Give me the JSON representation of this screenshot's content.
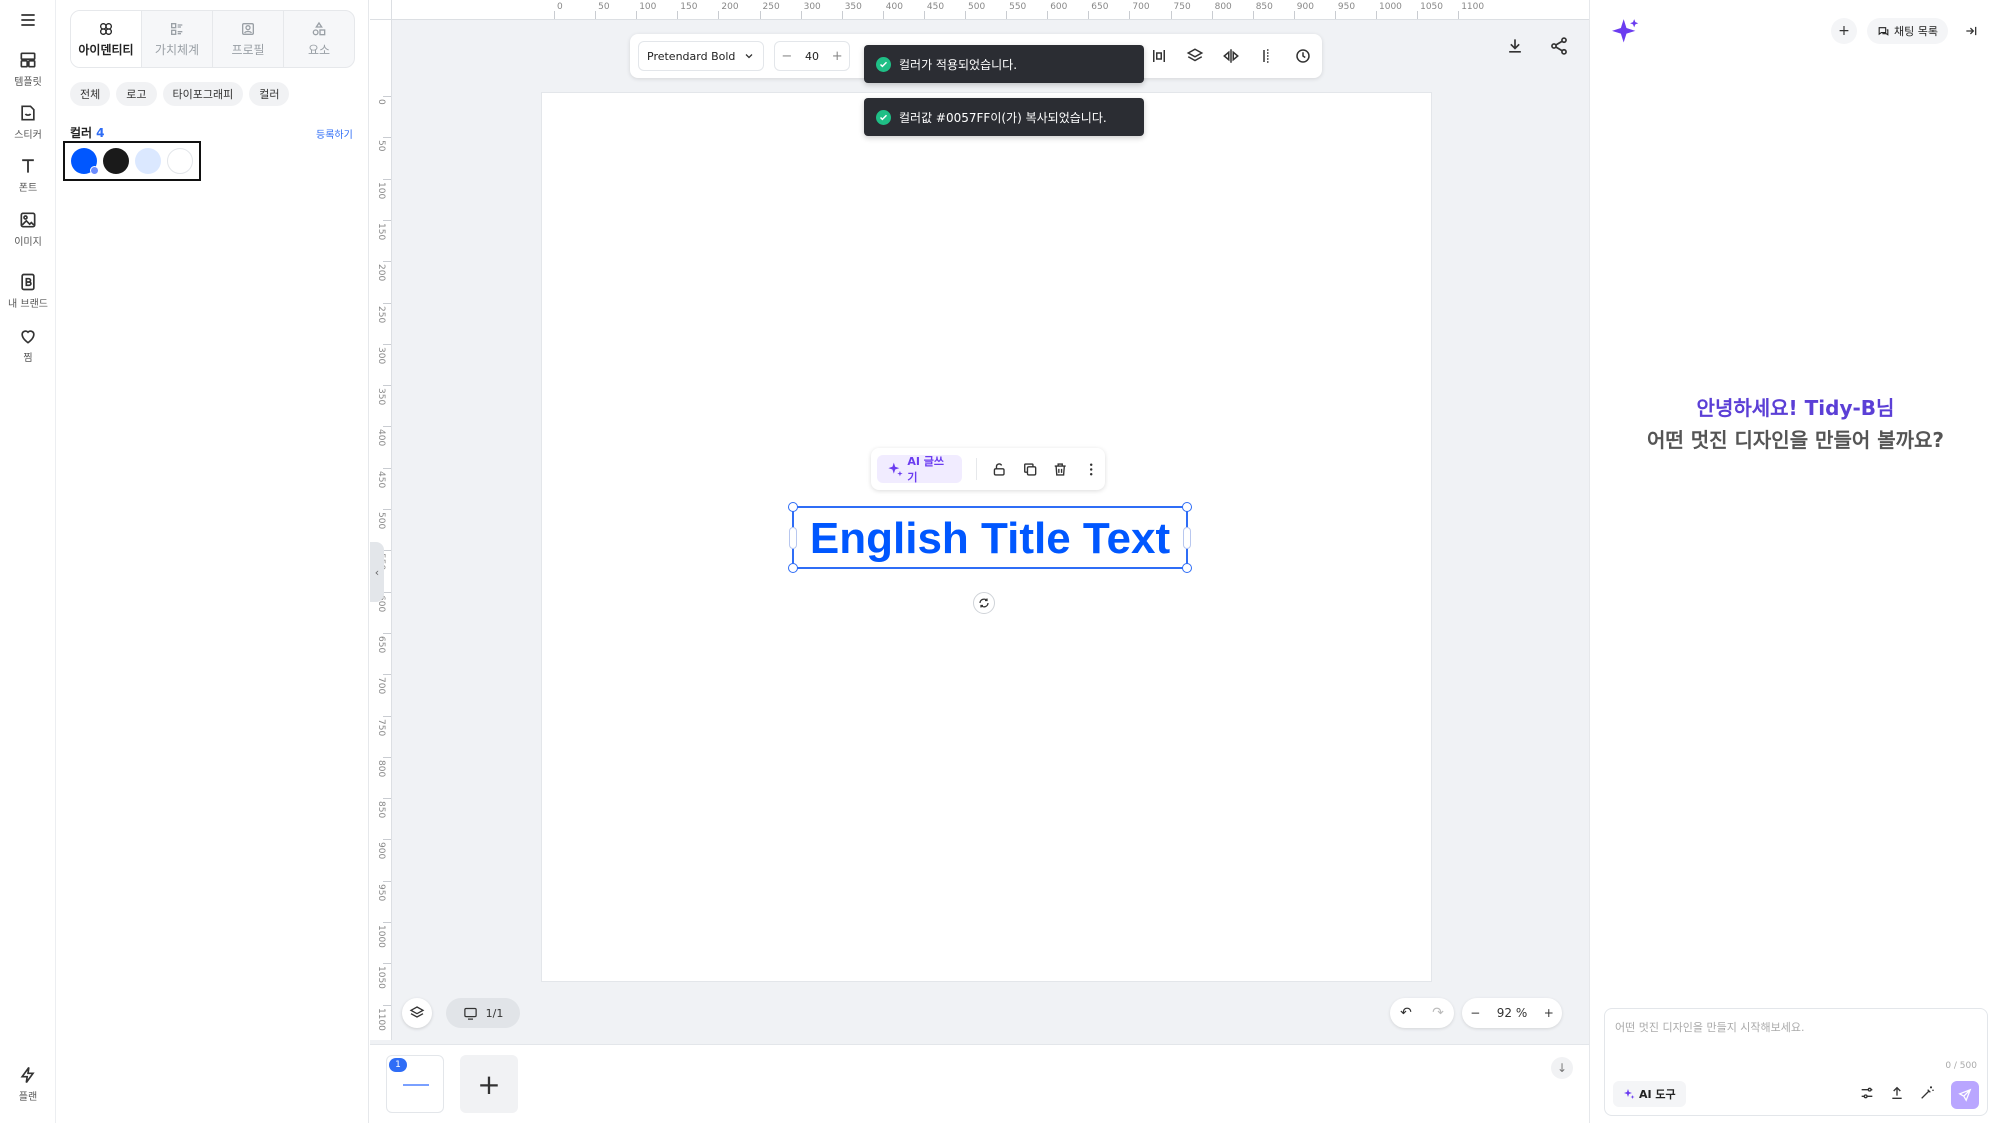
{
  "rail": {
    "items": [
      {
        "label": "",
        "icon": "menu-icon"
      },
      {
        "label": "템플릿",
        "icon": "template-icon"
      },
      {
        "label": "스티커",
        "icon": "sticker-icon"
      },
      {
        "label": "폰트",
        "icon": "font-icon"
      },
      {
        "label": "이미지",
        "icon": "image-icon"
      },
      {
        "label": "내 브랜드",
        "icon": "brand-icon"
      },
      {
        "label": "찜",
        "icon": "heart-icon"
      },
      {
        "label": "플랜",
        "icon": "bolt-icon"
      }
    ]
  },
  "panel": {
    "tabs": [
      {
        "label": "아이덴티티",
        "active": true
      },
      {
        "label": "가치체계",
        "active": false
      },
      {
        "label": "프로필",
        "active": false
      },
      {
        "label": "요소",
        "active": false
      }
    ],
    "chips": [
      "전체",
      "로고",
      "타이포그래피",
      "컬러"
    ],
    "color_section": {
      "title": "컬러",
      "count": "4",
      "register_label": "등록하기"
    },
    "swatches": [
      "#0057ff",
      "#1a1a1a",
      "#dbe8ff",
      "#ffffff"
    ]
  },
  "ruler": {
    "h": [
      "0",
      "50",
      "100",
      "150",
      "200",
      "250",
      "300",
      "350",
      "400",
      "450",
      "500",
      "550",
      "600",
      "650",
      "700",
      "750",
      "800",
      "850",
      "900",
      "950",
      "1000",
      "1050",
      "1100"
    ],
    "v": [
      "0",
      "50",
      "100",
      "150",
      "200",
      "250",
      "300",
      "350",
      "400",
      "450",
      "500",
      "550",
      "600",
      "650",
      "700",
      "750",
      "800",
      "850",
      "900",
      "950",
      "1000",
      "1050",
      "1100"
    ]
  },
  "toolbar": {
    "font": "Pretendard Bold",
    "size": "40"
  },
  "toasts": [
    {
      "text": "컬러가 적용되었습니다."
    },
    {
      "text": "컬러값 #0057FF이(가) 복사되었습니다."
    }
  ],
  "element_toolbar": {
    "ai_write_label": "AI 글쓰기"
  },
  "canvas": {
    "title_text": "English Title Text",
    "text_color": "#0057ff"
  },
  "bottom": {
    "page_indicator": "1/1",
    "zoom": "92",
    "zoom_unit": "%",
    "page_badge": "1",
    "add_page": "+"
  },
  "chat": {
    "list_label": "채팅 목록",
    "greeting_line1": "안녕하세요! Tidy-B님",
    "greeting_line2": "어떤 멋진 디자인을 만들어 볼까요?",
    "input_placeholder": "어떤 멋진 디자인을 만들지 시작해보세요.",
    "char_count": "0 / 500",
    "ai_tool_label": "AI 도구"
  },
  "colors": {
    "accent": "#2f6df6",
    "brand_purple": "#6b3cf0",
    "toast_bg": "#2b2d33",
    "success": "#1fbf86"
  }
}
